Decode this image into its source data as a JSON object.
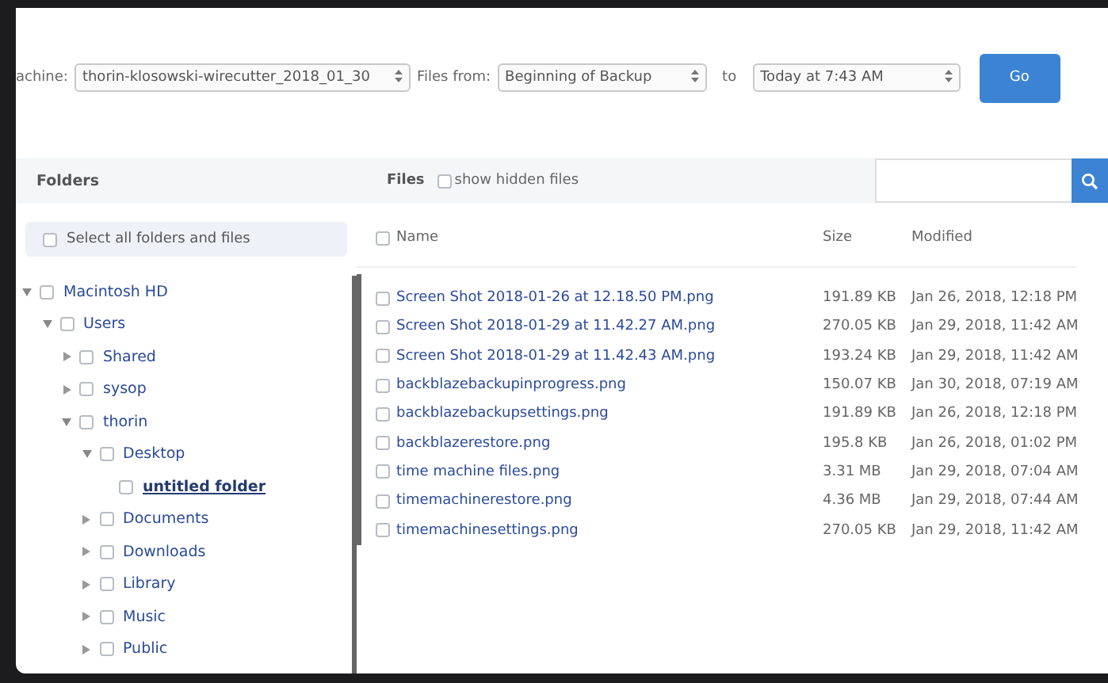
{
  "toolbar": {
    "machine_label": "achine:",
    "machine": "thorin-klosowski-wirecutter_2018_01_30",
    "files_from_label": "Files from:",
    "files_from": "Beginning of Backup",
    "to_label": "to",
    "to": "Today at 7:43 AM",
    "go_button": "Go"
  },
  "folders": {
    "title": "Folders",
    "select_all": {
      "label": "Select all folders and files",
      "checked": false
    },
    "tree": [
      {
        "label": "Macintosh HD",
        "checked": false,
        "expanded": true,
        "selected": false,
        "children": [
          {
            "label": "Users",
            "checked": false,
            "expanded": true,
            "selected": false,
            "children": [
              {
                "label": "Shared",
                "checked": false,
                "expanded": false,
                "selected": false
              },
              {
                "label": "sysop",
                "checked": false,
                "expanded": false,
                "selected": false
              },
              {
                "label": "thorin",
                "checked": false,
                "expanded": true,
                "selected": false,
                "children": [
                  {
                    "label": "Desktop",
                    "checked": false,
                    "expanded": true,
                    "selected": false,
                    "children": [
                      {
                        "label": "untitled folder",
                        "checked": false,
                        "selected": true
                      }
                    ]
                  },
                  {
                    "label": "Documents",
                    "checked": false,
                    "expanded": false,
                    "selected": false
                  },
                  {
                    "label": "Downloads",
                    "checked": false,
                    "expanded": false,
                    "selected": false
                  },
                  {
                    "label": "Library",
                    "checked": false,
                    "expanded": false,
                    "selected": false
                  },
                  {
                    "label": "Music",
                    "checked": false,
                    "expanded": false,
                    "selected": false
                  },
                  {
                    "label": "Public",
                    "checked": false,
                    "expanded": false,
                    "selected": false
                  }
                ]
              }
            ]
          }
        ]
      }
    ]
  },
  "files": {
    "title": "Files",
    "show_hidden": {
      "label": "show hidden files",
      "checked": false
    },
    "columns": [
      "Name",
      "Size",
      "Modified"
    ],
    "select_all_checked": false,
    "rows": [
      {
        "name": "Screen Shot 2018-01-26 at 12.18.50 PM.png",
        "size": "191.89 KB",
        "modified": "Jan 26, 2018, 12:18 PM",
        "checked": false
      },
      {
        "name": "Screen Shot 2018-01-29 at 11.42.27 AM.png",
        "size": "270.05 KB",
        "modified": "Jan 29, 2018, 11:42 AM",
        "checked": false
      },
      {
        "name": "Screen Shot 2018-01-29 at 11.42.43 AM.png",
        "size": "193.24 KB",
        "modified": "Jan 29, 2018, 11:42 AM",
        "checked": false
      },
      {
        "name": "backblazebackupinprogress.png",
        "size": "150.07 KB",
        "modified": "Jan 30, 2018, 07:19 AM",
        "checked": false
      },
      {
        "name": "backblazebackupsettings.png",
        "size": "191.89 KB",
        "modified": "Jan 26, 2018, 12:18 PM",
        "checked": false
      },
      {
        "name": "backblazerestore.png",
        "size": "195.8 KB",
        "modified": "Jan 26, 2018, 01:02 PM",
        "checked": false
      },
      {
        "name": "time machine files.png",
        "size": "3.31 MB",
        "modified": "Jan 29, 2018, 07:04 AM",
        "checked": false
      },
      {
        "name": "timemachinerestore.png",
        "size": "4.36 MB",
        "modified": "Jan 29, 2018, 07:44 AM",
        "checked": false
      },
      {
        "name": "timemachinesettings.png",
        "size": "270.05 KB",
        "modified": "Jan 29, 2018, 11:42 AM",
        "checked": false
      }
    ]
  }
}
